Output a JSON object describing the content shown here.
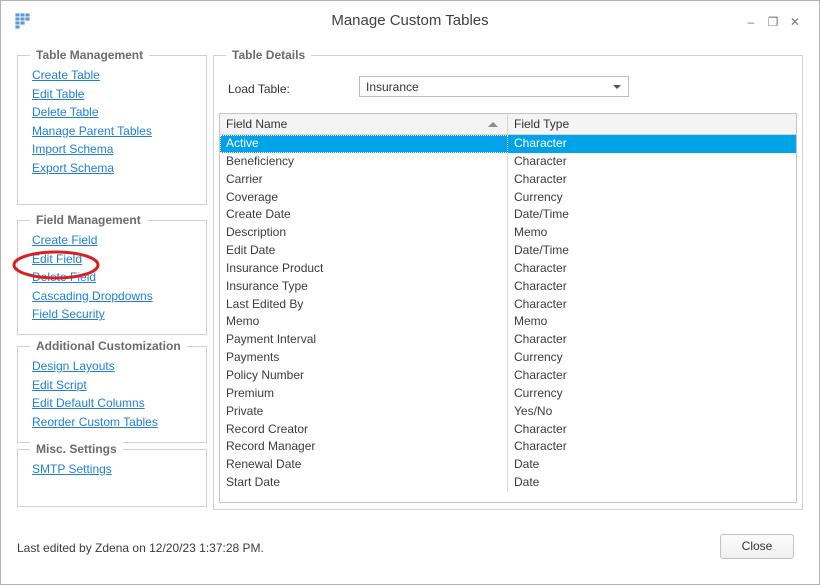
{
  "window": {
    "title": "Manage Custom Tables",
    "icon": "table-grid-icon",
    "minimize_label": "–",
    "maximize_label": "❐",
    "close_label": "✕"
  },
  "panels": {
    "table_management": {
      "legend": "Table Management",
      "links": [
        "Create Table",
        "Edit Table",
        "Delete Table",
        "Manage Parent Tables",
        "Import Schema",
        "Export Schema"
      ]
    },
    "field_management": {
      "legend": "Field Management",
      "links": [
        "Create Field",
        "Edit Field",
        "Delete Field",
        "Cascading Dropdowns",
        "Field Security"
      ]
    },
    "additional_customization": {
      "legend": "Additional Customization",
      "links": [
        "Design Layouts",
        "Edit Script",
        "Edit Default Columns",
        "Reorder Custom Tables"
      ]
    },
    "misc_settings": {
      "legend": "Misc. Settings",
      "links": [
        "SMTP Settings"
      ]
    }
  },
  "table_details": {
    "legend": "Table Details",
    "load_table_label": "Load Table:",
    "load_table_value": "Insurance",
    "columns": [
      "Field Name",
      "Field Type"
    ],
    "sort_column": "Field Name",
    "sort_direction": "ascending",
    "selected_row_index": 0,
    "rows": [
      {
        "name": "Active",
        "type": "Character"
      },
      {
        "name": "Beneficiency",
        "type": "Character"
      },
      {
        "name": "Carrier",
        "type": "Character"
      },
      {
        "name": "Coverage",
        "type": "Currency"
      },
      {
        "name": "Create Date",
        "type": "Date/Time"
      },
      {
        "name": "Description",
        "type": "Memo"
      },
      {
        "name": "Edit Date",
        "type": "Date/Time"
      },
      {
        "name": "Insurance Product",
        "type": "Character"
      },
      {
        "name": "Insurance Type",
        "type": "Character"
      },
      {
        "name": "Last Edited By",
        "type": "Character"
      },
      {
        "name": "Memo",
        "type": "Memo"
      },
      {
        "name": "Payment Interval",
        "type": "Character"
      },
      {
        "name": "Payments",
        "type": "Currency"
      },
      {
        "name": "Policy Number",
        "type": "Character"
      },
      {
        "name": "Premium",
        "type": "Currency"
      },
      {
        "name": "Private",
        "type": "Yes/No"
      },
      {
        "name": "Record Creator",
        "type": "Character"
      },
      {
        "name": "Record Manager",
        "type": "Character"
      },
      {
        "name": "Renewal Date",
        "type": "Date"
      },
      {
        "name": "Start Date",
        "type": "Date"
      }
    ]
  },
  "footer": {
    "status": "Last edited by Zdena on 12/20/23 1:37:28 PM.",
    "close_button": "Close"
  },
  "annotation": {
    "target": "Edit Field",
    "shape": "ellipse",
    "color": "#d81f22"
  },
  "colors": {
    "link": "#1f7fd4",
    "selection": "#00a2e8",
    "legend_text": "#6b6b6b",
    "annotation": "#d81f22"
  }
}
